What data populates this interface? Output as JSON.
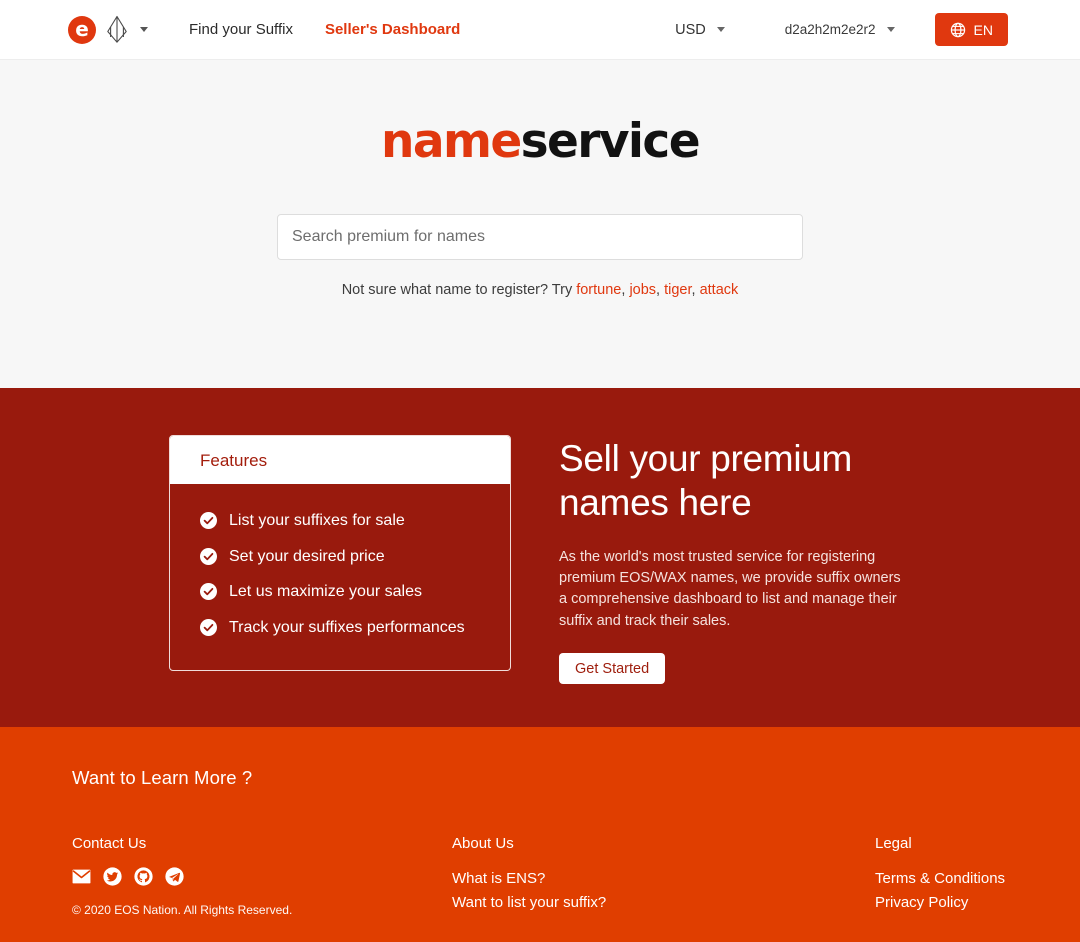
{
  "header": {
    "brand": {
      "eos_letter": "e",
      "eos_mark_name": "eos-diamond-logo"
    },
    "nav": [
      {
        "label": "Find your Suffix",
        "accent": false
      },
      {
        "label": "Seller's Dashboard",
        "accent": true
      }
    ],
    "currency": "USD",
    "account": "d2a2h2m2e2r2",
    "language": "EN"
  },
  "hero": {
    "logo_first": "name",
    "logo_second": "service",
    "search_placeholder": "Search premium for names",
    "search_value": "",
    "hint_prefix": "Not sure what name to register? Try ",
    "suggestions": [
      "fortune",
      "jobs",
      "tiger",
      "attack"
    ]
  },
  "sell": {
    "card": {
      "title": "Features",
      "items": [
        "List your suffixes for sale",
        "Set your desired price",
        "Let us maximize your sales",
        "Track your suffixes performances"
      ]
    },
    "title": "Sell your premium names here",
    "description": "As the world's most trusted service for registering premium EOS/WAX names, we provide suffix owners a comprehensive dashboard to list and manage their suffix and track their sales.",
    "cta": "Get Started"
  },
  "footer": {
    "heading": "Want to Learn More ?",
    "contact": {
      "title": "Contact Us",
      "socials": [
        "email-icon",
        "twitter-icon",
        "github-icon",
        "telegram-icon"
      ]
    },
    "about": {
      "title": "About Us",
      "links": [
        "What is ENS?",
        "Want to list your suffix?"
      ]
    },
    "legal": {
      "title": "Legal",
      "links": [
        "Terms & Conditions",
        "Privacy Policy"
      ]
    },
    "copyright": "© 2020 EOS Nation. All Rights Reserved."
  },
  "colors": {
    "accent_orange": "#e0380f",
    "footer_orange": "#e03e00",
    "deep_red": "#991a0d",
    "hero_bg": "#f7f7f7"
  }
}
